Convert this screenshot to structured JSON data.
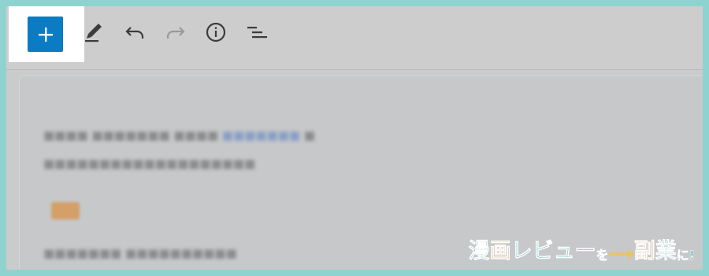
{
  "toolbar": {
    "icons": [
      "plus-icon",
      "pencil-icon",
      "undo-icon",
      "redo-icon",
      "info-icon",
      "list-view-icon"
    ],
    "colors": {
      "accent": "#0b7bc3",
      "icon": "#3c3c3c",
      "icon_disabled": "#9a9a9a"
    }
  },
  "logo": {
    "part1": "漫",
    "part2": "画",
    "part3": "レビュー",
    "part4": "を",
    "part5": "副",
    "part6": "業",
    "part7": "に!",
    "colors": {
      "teal": "#6bbfbf",
      "yellow": "#e7c46a",
      "orange": "#e0a04e"
    }
  }
}
